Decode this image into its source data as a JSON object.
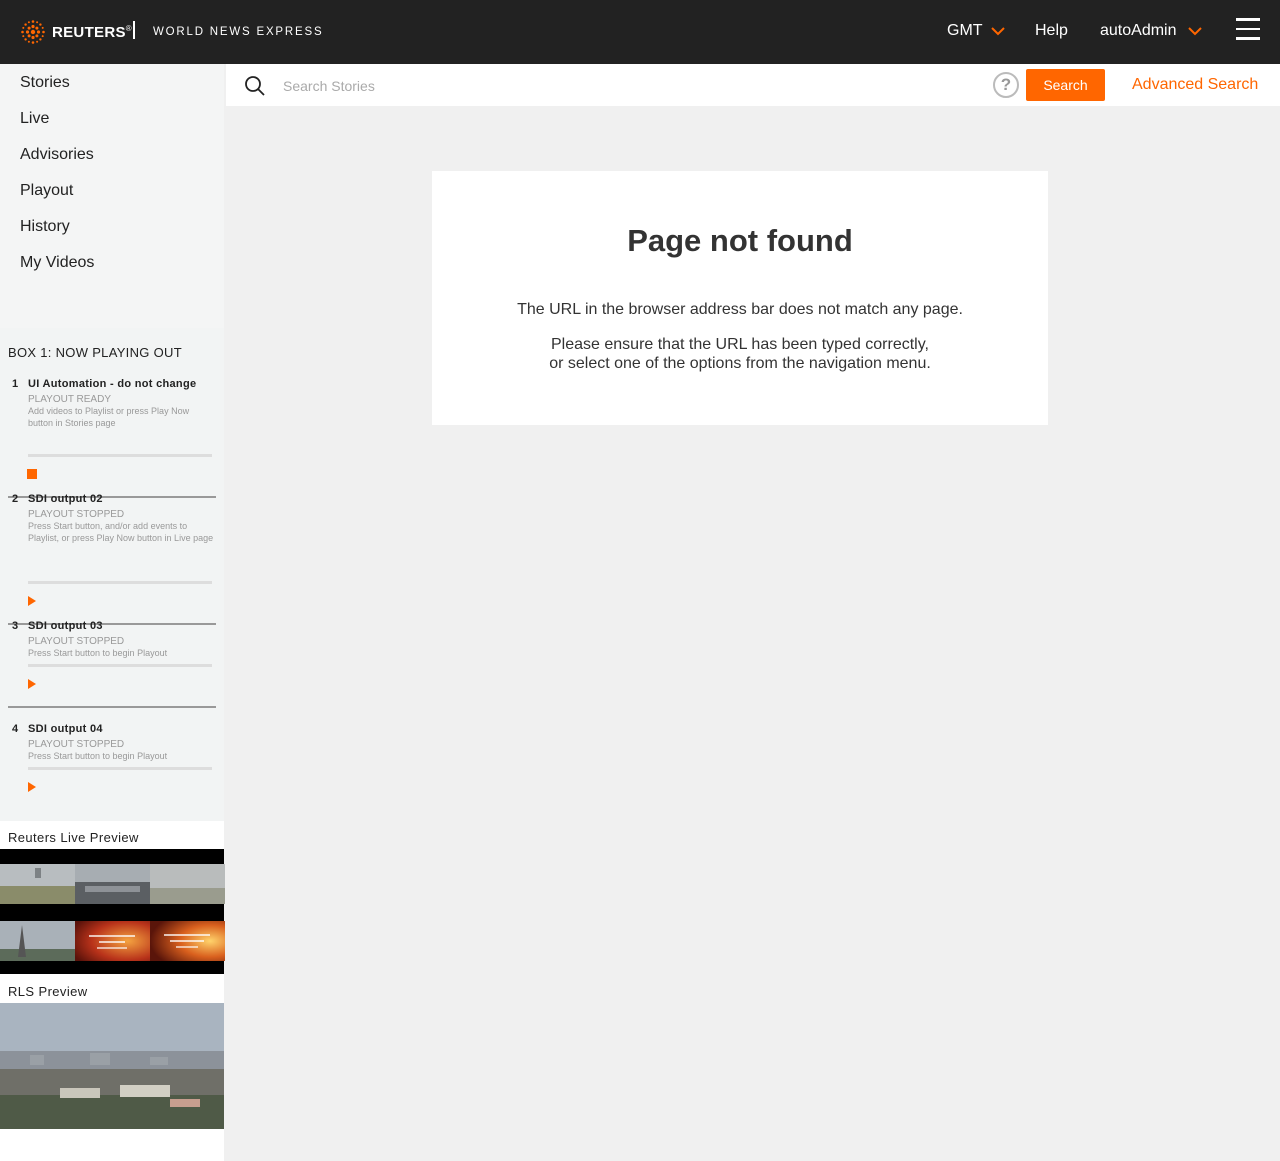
{
  "header": {
    "brand": "REUTERS",
    "brand_trademark": "®",
    "subbrand": "WORLD NEWS EXPRESS",
    "timezone": "GMT",
    "help": "Help",
    "user": "autoAdmin",
    "logo_icon": "reuters-logo-icon",
    "menu_icon": "hamburger-menu-icon"
  },
  "sidebar": {
    "nav": [
      "Stories",
      "Live",
      "Advisories",
      "Playout",
      "History",
      "My Videos"
    ],
    "now_playing": {
      "title": "BOX 1: NOW PLAYING OUT",
      "items": [
        {
          "num": "1",
          "name": "UI Automation - do not change",
          "status": "PLAYOUT READY",
          "desc": "Add videos to Playlist or press Play Now button in Stories page",
          "control": "stop"
        },
        {
          "num": "2",
          "name": "SDI output 02",
          "status": "PLAYOUT STOPPED",
          "desc": "Press Start button, and/or add events to Playlist, or press Play Now button in Live page",
          "control": "play"
        },
        {
          "num": "3",
          "name": "SDI output 03",
          "status": "PLAYOUT STOPPED",
          "desc": "Press Start button to begin Playout",
          "control": "play"
        },
        {
          "num": "4",
          "name": "SDI output 04",
          "status": "PLAYOUT STOPPED",
          "desc": "Press Start button to begin Playout",
          "control": "play"
        }
      ]
    },
    "live_preview_title": "Reuters Live Preview",
    "rls_preview_title": "RLS Preview"
  },
  "search": {
    "placeholder": "Search Stories",
    "help_glyph": "?",
    "button": "Search",
    "advanced": "Advanced Search"
  },
  "error": {
    "title": "Page not found",
    "line1": "The URL in the browser address bar does not match any page.",
    "line2": "Please ensure that the URL has been typed correctly,",
    "line3": "or select one of the options from the navigation menu."
  },
  "colors": {
    "accent": "#ff6600",
    "topbar": "#222222",
    "background": "#f0f0f0"
  }
}
